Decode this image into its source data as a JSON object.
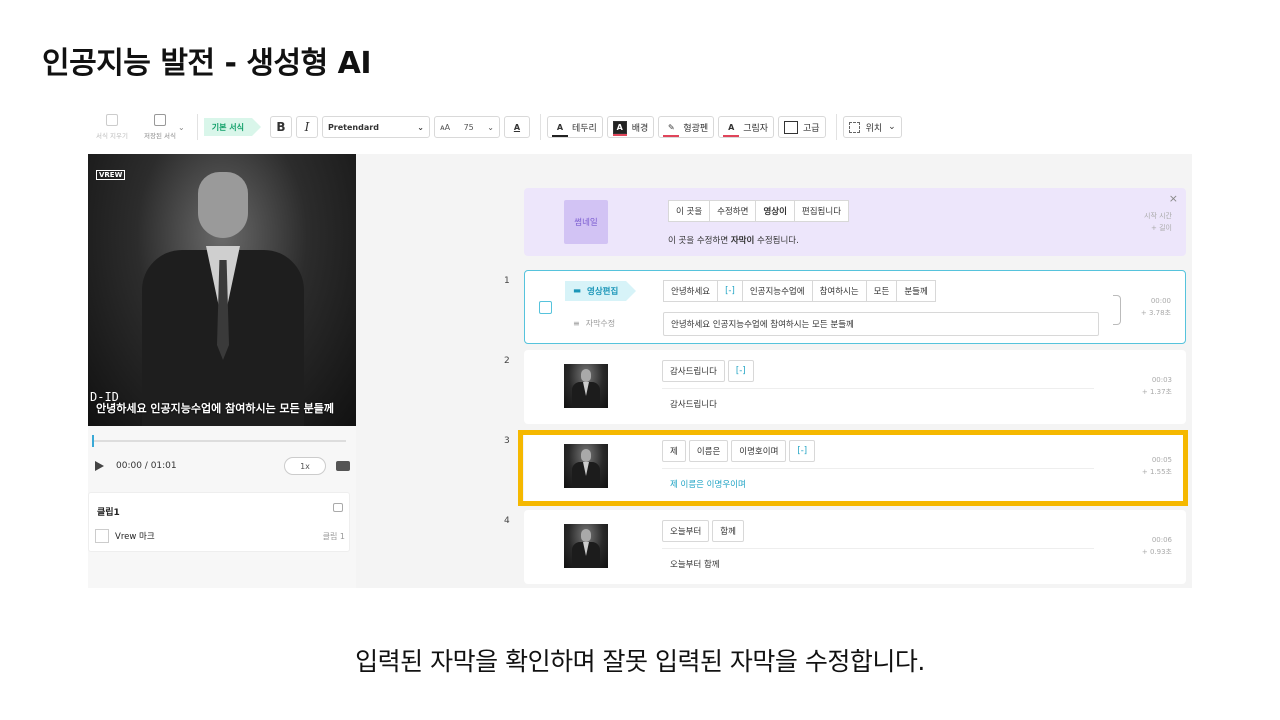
{
  "slide": {
    "title": "인공지능 발전 - 생성형 AI",
    "caption": "입력된 자막을 확인하며 잘못 입력된 자막을 수정합니다."
  },
  "toolbar": {
    "clear_format": "서식 지우기",
    "saved_format": "저장된 서식",
    "basic_format_tag": "기본 서식",
    "bold": "B",
    "italic": "I",
    "font_name": "Pretendard",
    "font_size_icon": "ᴀA",
    "font_size": "75",
    "font_color_glyph": "A",
    "border": "테두리",
    "background": "배경",
    "highlighter": "형광펜",
    "shadow": "그림자",
    "advanced": "고급",
    "position": "위치"
  },
  "player": {
    "logo": "VREW",
    "subtitle": "안녕하세요 인공지능수업에 참여하시는 모든 분들께",
    "mark": "D-ID",
    "time": "00:00 / 01:01",
    "speed": "1x",
    "progress": 0
  },
  "clips": {
    "title": "클립1",
    "row_label": "Vrew 마크",
    "row_tag": "클립 1"
  },
  "thumbnail_card": {
    "label": "썸네일",
    "words": [
      "이 곳을",
      "수정하면",
      "영상이",
      "편집됩니다"
    ],
    "bold_word_index": 2,
    "text_before": "이 곳을 수정하면 ",
    "text_bold": "자막이",
    "text_after": " 수정됩니다.",
    "meta_1": "시작 시간",
    "meta_2": "+ 길이",
    "close": "×"
  },
  "rows": [
    {
      "num": "1",
      "tag": "영상편집",
      "subtitle_edit_label": "자막수정",
      "words": [
        "안녕하세요",
        "[-]",
        "인공지능수업에",
        "참여하시는",
        "모든",
        "분들께"
      ],
      "text": "안녕하세요 인공지능수업에 참여하시는 모든 분들께",
      "time": "00:00",
      "length": "+ 3.78초"
    },
    {
      "num": "2",
      "words": [
        "감사드립니다",
        "[-]"
      ],
      "text": "감사드립니다",
      "time": "00:03",
      "length": "+ 1.37초"
    },
    {
      "num": "3",
      "words": [
        "제",
        "이름은",
        "이명호이며",
        "[-]"
      ],
      "text": "제 이름은 이명우이며",
      "time": "00:05",
      "length": "+ 1.55초"
    },
    {
      "num": "4",
      "words": [
        "오늘부터",
        "함께"
      ],
      "text": "오늘부터 함께",
      "time": "00:06",
      "length": "+ 0.93초"
    }
  ],
  "colors": {
    "accent_teal": "#1ea3c4",
    "highlight_yellow": "#f5b800",
    "thumbnail_purple": "#ede6fb",
    "tag_green": "#12a06a"
  }
}
